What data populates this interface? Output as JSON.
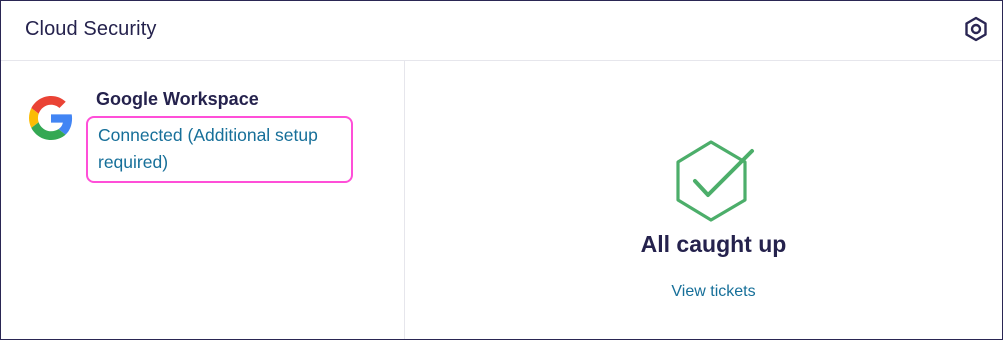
{
  "header": {
    "title": "Cloud Security",
    "settings_icon": "settings-hexagon-icon"
  },
  "integration": {
    "name": "Google Workspace",
    "status": "Connected (Additional setup required)",
    "icon": "google-g-icon",
    "highlight_color": "#ff4fd8"
  },
  "empty_state": {
    "icon": "hexagon-check-icon",
    "icon_color": "#4cae6a",
    "title": "All caught up",
    "link_label": "View tickets"
  },
  "colors": {
    "text_dark": "#25224d",
    "link": "#166f99",
    "border": "#2a2653"
  }
}
